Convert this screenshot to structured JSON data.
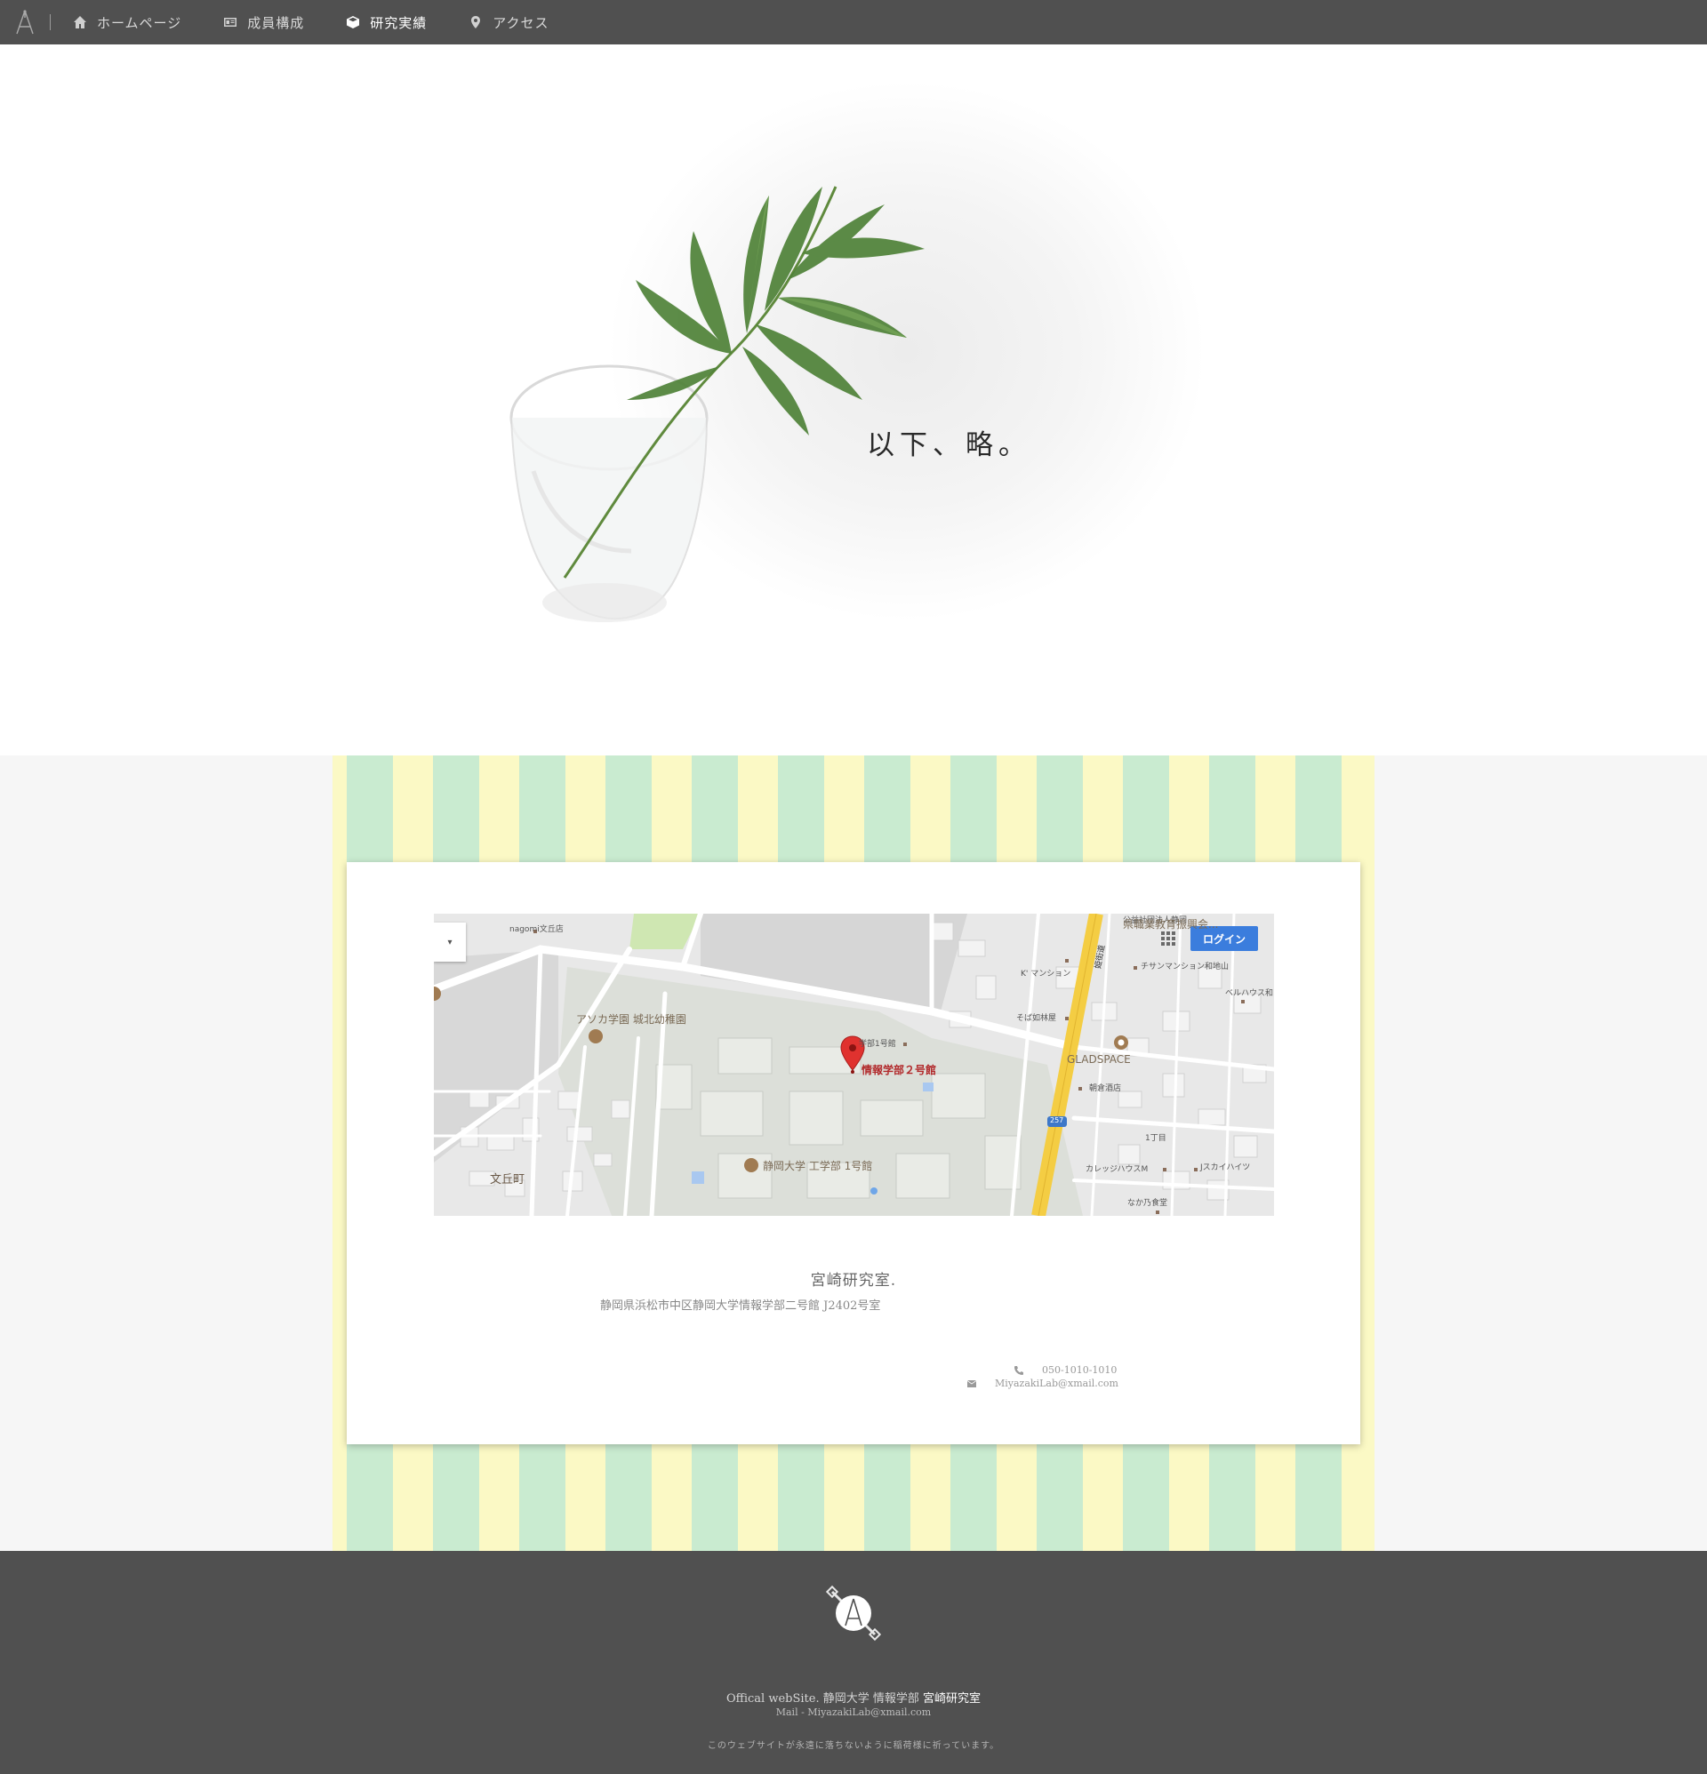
{
  "nav": {
    "items": [
      {
        "label": "ホームページ",
        "icon": "home-icon"
      },
      {
        "label": "成員構成",
        "icon": "id-card-icon"
      },
      {
        "label": "研究実績",
        "icon": "cube-icon",
        "active": true
      },
      {
        "label": "アクセス",
        "icon": "map-marker-icon"
      }
    ]
  },
  "hero": {
    "title": "以下、略。"
  },
  "map": {
    "login": "ログイン",
    "labels": {
      "nagomi": "nagomi文丘店",
      "prefecture_line1": "公益社団法人静岡",
      "prefecture_line2": "県職業教育振興会...",
      "k_mansion": "K' マンション",
      "chisan": "チサンマンション和地山",
      "bellhaus": "ベルハウス和",
      "soba": "そば如林屋",
      "asoka": "アソカ学園 城北幼稚園",
      "bldg1_small": "学部1号館",
      "destination": "情報学部２号館",
      "gladspace": "GLADSPACE",
      "asakura": "朝倉酒店",
      "chome": "1丁目",
      "college": "カレッジハウスM",
      "jsky": "Jスカイハイツ",
      "nakano": "なか乃食堂",
      "engineering": "静岡大学 工学部 1号館",
      "bunkyo": "文丘町",
      "road_name": "姫街道",
      "route": "257"
    }
  },
  "lab": {
    "name": "宮崎研究室.",
    "address": "静岡県浜松市中区静岡大学情報学部二号館 J2402号室",
    "phone": "050-1010-1010",
    "email": "MiyazakiLab@xmail.com"
  },
  "footer": {
    "site_prefix": "Offical webSite. 静岡大学 情報学部",
    "site_lab": "宮崎研究室",
    "mail": "Mail - MiyazakiLab@xmail.com",
    "note": "このウェブサイトが永遠に落ちないように稲荷様に祈っています。"
  },
  "colors": {
    "nav_bg": "#505050",
    "stripe_green": "#c9ebd0",
    "stripe_yellow": "#fbf9c5",
    "map_road_major": "#f4cd43",
    "login_blue": "#3b7ddd",
    "marker_red": "#e0322f"
  }
}
